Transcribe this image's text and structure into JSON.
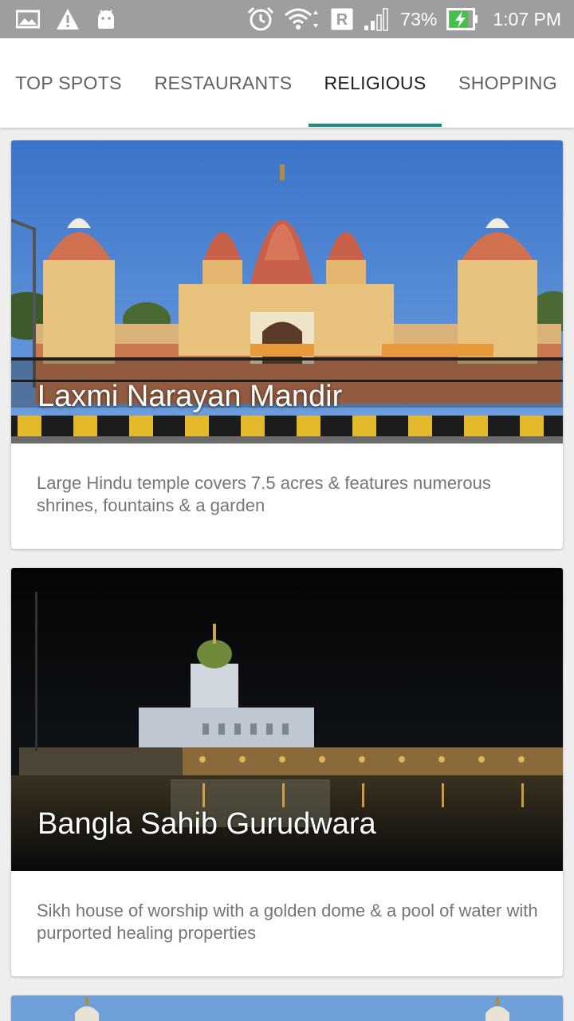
{
  "status_bar": {
    "battery_percent": "73%",
    "time": "1:07 PM",
    "roaming_label": "R",
    "icons": [
      "image-icon",
      "warning-icon",
      "android-icon",
      "alarm-icon",
      "wifi-icon",
      "roaming-icon",
      "signal-icon",
      "battery-charging-icon"
    ]
  },
  "tabs": [
    {
      "label": "TOP SPOTS"
    },
    {
      "label": "RESTAURANTS"
    },
    {
      "label": "RELIGIOUS"
    },
    {
      "label": "SHOPPING"
    }
  ],
  "active_tab": "RELIGIOUS",
  "accent_color": "#148f83",
  "cards": [
    {
      "title": "Laxmi Narayan Mandir",
      "description": "Large Hindu temple covers 7.5 acres & features numerous shrines, fountains & a garden"
    },
    {
      "title": "Bangla Sahib Gurudwara",
      "description": "Sikh house of worship with a golden dome & a pool of water with purported healing properties"
    }
  ]
}
